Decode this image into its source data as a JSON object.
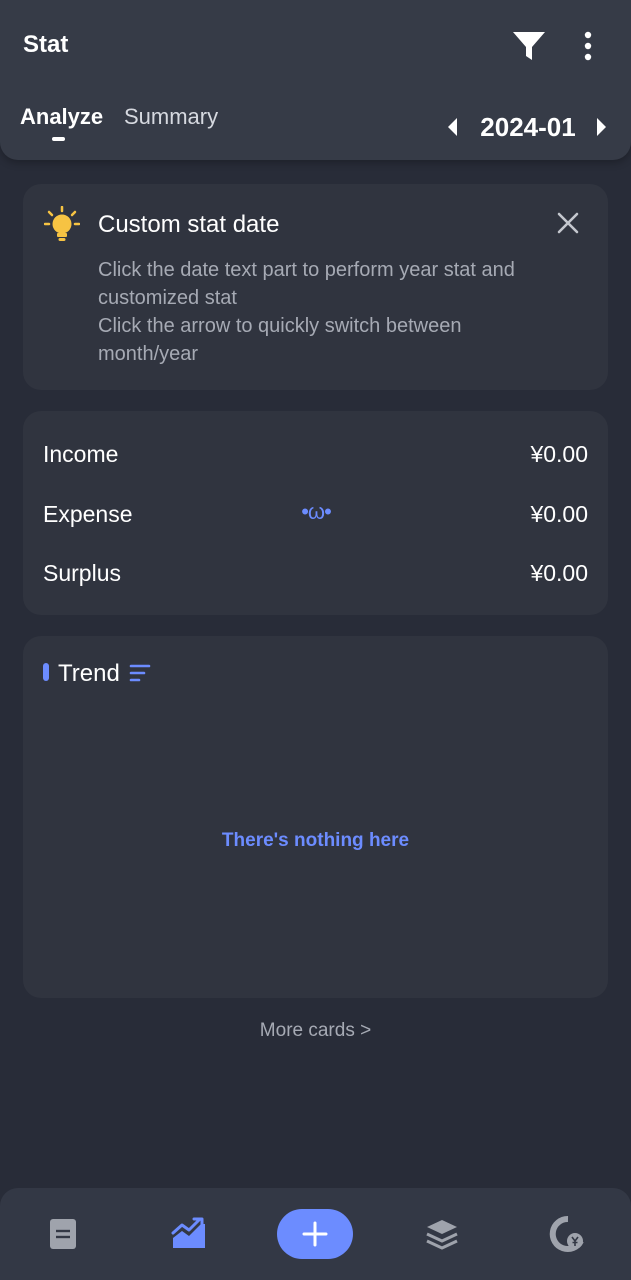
{
  "header": {
    "title": "Stat",
    "tabs": [
      {
        "label": "Analyze",
        "active": true
      },
      {
        "label": "Summary",
        "active": false
      }
    ],
    "date": "2024-01",
    "icons": [
      "filter-icon",
      "more-vert-icon",
      "caret-left-icon",
      "caret-right-icon"
    ]
  },
  "tip": {
    "title": "Custom stat date",
    "body_line1": "Click the date text part to perform year stat and customized stat",
    "body_line2": "Click the arrow to quickly switch between month/year",
    "icons": [
      "bulb-icon",
      "close-icon"
    ]
  },
  "summary": {
    "income_label": "Income",
    "income_value": "¥0.00",
    "expense_label": "Expense",
    "expense_value": "¥0.00",
    "surplus_label": "Surplus",
    "surplus_value": "¥0.00",
    "emoji": "•ω•"
  },
  "trend": {
    "title": "Trend",
    "empty_text": "There's nothing here",
    "icons": [
      "sort-icon"
    ]
  },
  "more_cards": "More cards >",
  "bottom_nav": {
    "items": [
      "bills-icon",
      "stat-icon",
      "add-icon",
      "assets-icon",
      "budget-icon"
    ],
    "active": "stat-icon"
  },
  "colors": {
    "background": "#282c38",
    "header": "#363b47",
    "card": "#30343f",
    "accent": "#6c8cff",
    "bulb": "#f6c343",
    "muted_text": "#a6aab4"
  }
}
